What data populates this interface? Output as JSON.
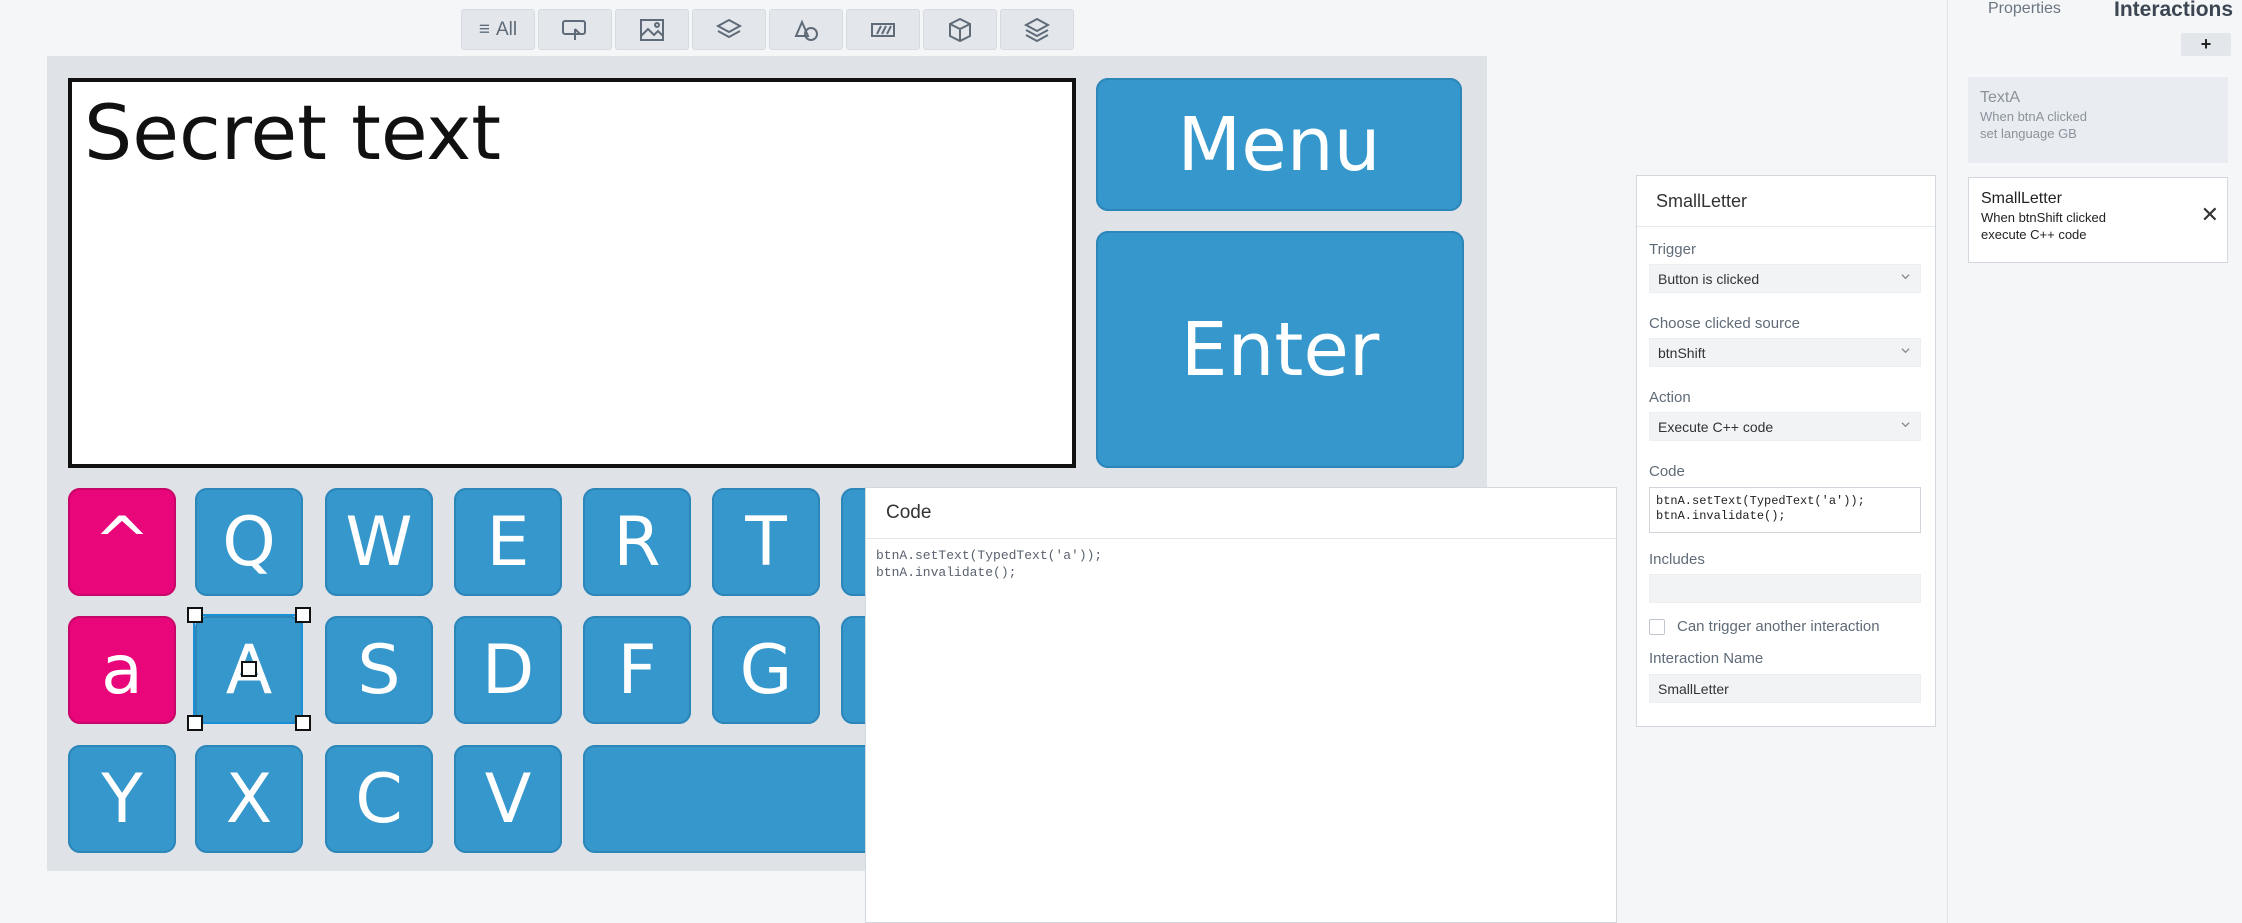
{
  "toolbar": {
    "all_label": "All",
    "icons": [
      "interaction-hand-icon",
      "image-icon",
      "layers-icon",
      "shapes-icon",
      "slider-icon",
      "cube-icon",
      "layer-stack-icon"
    ]
  },
  "canvas": {
    "screen_text": "Secret text",
    "menu_label": "Menu",
    "enter_label": "Enter",
    "row1": [
      "^",
      "Q",
      "W",
      "E",
      "R",
      "T"
    ],
    "row2": [
      "a",
      "A",
      "S",
      "D",
      "F",
      "G"
    ],
    "row3": [
      "Y",
      "X",
      "C",
      "V"
    ]
  },
  "code_window": {
    "title": "Code",
    "code": "btnA.setText(TypedText('a'));\nbtnA.invalidate();"
  },
  "panel": {
    "tab_properties": "Properties",
    "tab_interactions": "Interactions",
    "add_label": "+",
    "cards": [
      {
        "name": "TextA",
        "line1": "When btnA clicked",
        "line2": "set language GB"
      },
      {
        "name": "SmallLetter",
        "line1": "When btnShift clicked",
        "line2": "execute C++ code"
      }
    ]
  },
  "editor": {
    "title": "SmallLetter",
    "trigger_label": "Trigger",
    "trigger_value": "Button is clicked",
    "source_label": "Choose clicked source",
    "source_value": "btnShift",
    "action_label": "Action",
    "action_value": "Execute C++ code",
    "code_label": "Code",
    "code_value": "btnA.setText(TypedText('a'));\nbtnA.invalidate();",
    "includes_label": "Includes",
    "includes_value": "",
    "trigger_another_label": "Can trigger another interaction",
    "name_label": "Interaction Name",
    "name_value": "SmallLetter"
  }
}
